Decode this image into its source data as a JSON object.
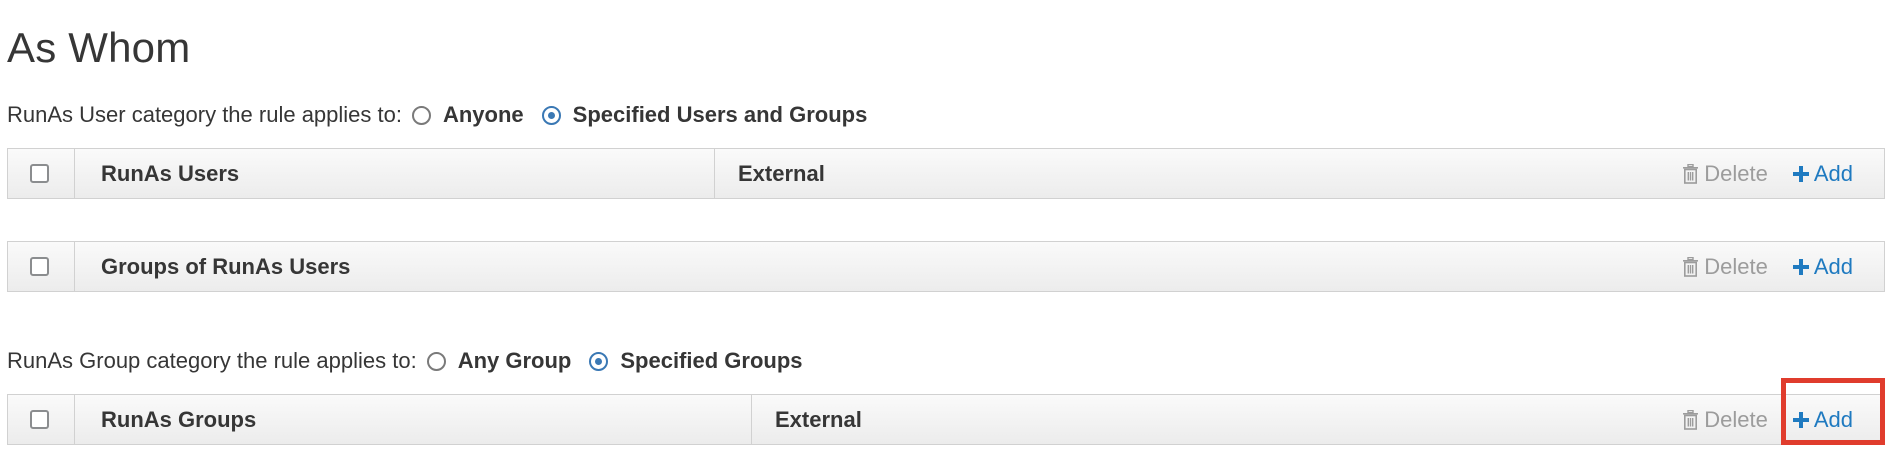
{
  "section": {
    "title": "As Whom"
  },
  "runas_user_category": {
    "label": "RunAs User category the rule applies to:",
    "options": [
      {
        "label": "Anyone",
        "checked": false
      },
      {
        "label": "Specified Users and Groups",
        "checked": true
      }
    ]
  },
  "runas_users_table": {
    "column": "RunAs Users",
    "external_column": "External",
    "delete_label": "Delete",
    "add_label": "Add"
  },
  "runas_user_groups_table": {
    "column": "Groups of RunAs Users",
    "delete_label": "Delete",
    "add_label": "Add"
  },
  "runas_group_category": {
    "label": "RunAs Group category the rule applies to:",
    "options": [
      {
        "label": "Any Group",
        "checked": false
      },
      {
        "label": "Specified Groups",
        "checked": true
      }
    ]
  },
  "runas_groups_table": {
    "column": "RunAs Groups",
    "external_column": "External",
    "delete_label": "Delete",
    "add_label": "Add"
  },
  "colors": {
    "link": "#1f7ac0",
    "disabled": "#9c9c9c",
    "radio_checked": "#3a78b4",
    "highlight": "#e03c2d",
    "border": "#d1d1d1"
  },
  "icons": {
    "delete": "trash-icon",
    "add": "plus-icon"
  }
}
